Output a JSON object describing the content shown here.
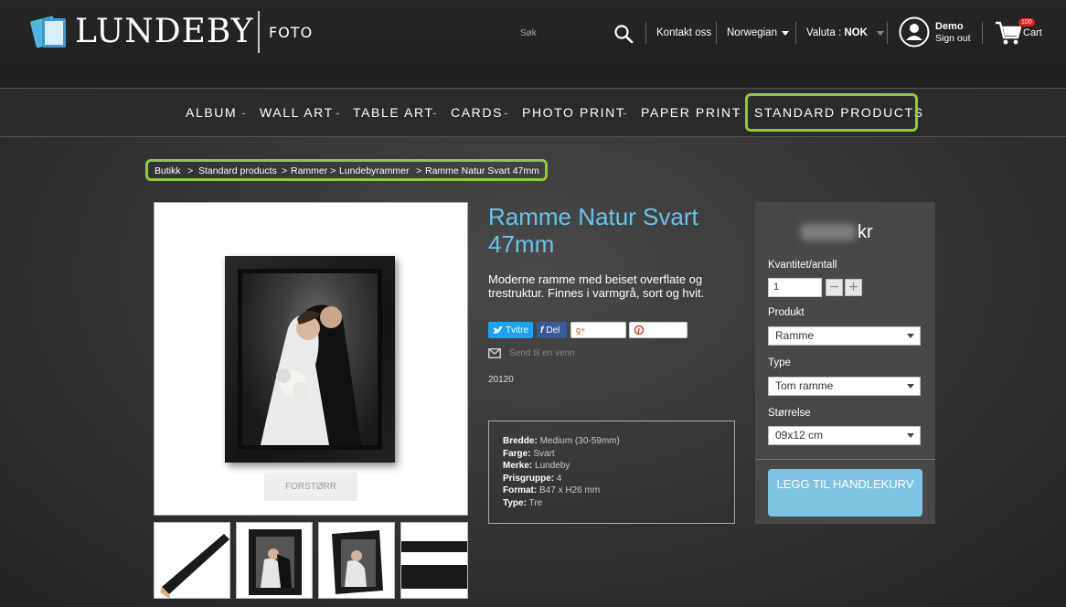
{
  "brand": {
    "name": "LUNDEBY",
    "sub": "FOTO"
  },
  "header": {
    "search_placeholder": "Søk",
    "contact": "Kontakt oss",
    "language": "Norwegian",
    "currency_label": "Valuta :",
    "currency_value": "NOK",
    "user_name": "Demo",
    "sign_out": "Sign out",
    "cart_label": "Cart",
    "cart_count": "100"
  },
  "nav": {
    "items": [
      "ALBUM",
      "WALL ART",
      "TABLE ART",
      "CARDS",
      "PHOTO PRINT",
      "PAPER PRINT",
      "STANDARD PRODUCTS"
    ],
    "separator": "-"
  },
  "breadcrumb": [
    "Butikk",
    ">",
    "Standard products",
    ">",
    "Rammer",
    ">",
    "Lundebyrammer",
    ">",
    "Ramme Natur Svart 47mm"
  ],
  "gallery": {
    "enlarge_label": "FORSTØRR"
  },
  "product": {
    "title": "Ramme Natur Svart 47mm",
    "description": "Moderne ramme med beiset overflate og trestruktur. Finnes i varmgrå, sort og hvit.",
    "tweet": "Tvitre",
    "share": "Del",
    "send_to_friend": "Send til en venn",
    "reference": "20120",
    "specs": [
      {
        "label": "Bredde:",
        "value": "Medium (30-59mm)"
      },
      {
        "label": "Farge:",
        "value": "Svart"
      },
      {
        "label": "Merke:",
        "value": "Lundeby"
      },
      {
        "label": "Prisgruppe:",
        "value": "4"
      },
      {
        "label": "Format:",
        "value": "B47 x H26 mm"
      },
      {
        "label": "Type:",
        "value": "Tre"
      }
    ]
  },
  "buybox": {
    "price_currency": "kr",
    "quantity_label": "Kvantitet/antall",
    "quantity_value": "1",
    "product_label": "Produkt",
    "product_value": "Ramme",
    "type_label": "Type",
    "type_value": "Tom ramme",
    "size_label": "Størrelse",
    "size_value": "09x12 cm",
    "add_to_cart": "LEGG TIL HANDLEKURV"
  },
  "colors": {
    "accent_blue": "#6bc2ea",
    "highlight_green": "#8fc93c",
    "button_blue": "#7cc4e2",
    "badge_red": "#e02020"
  }
}
